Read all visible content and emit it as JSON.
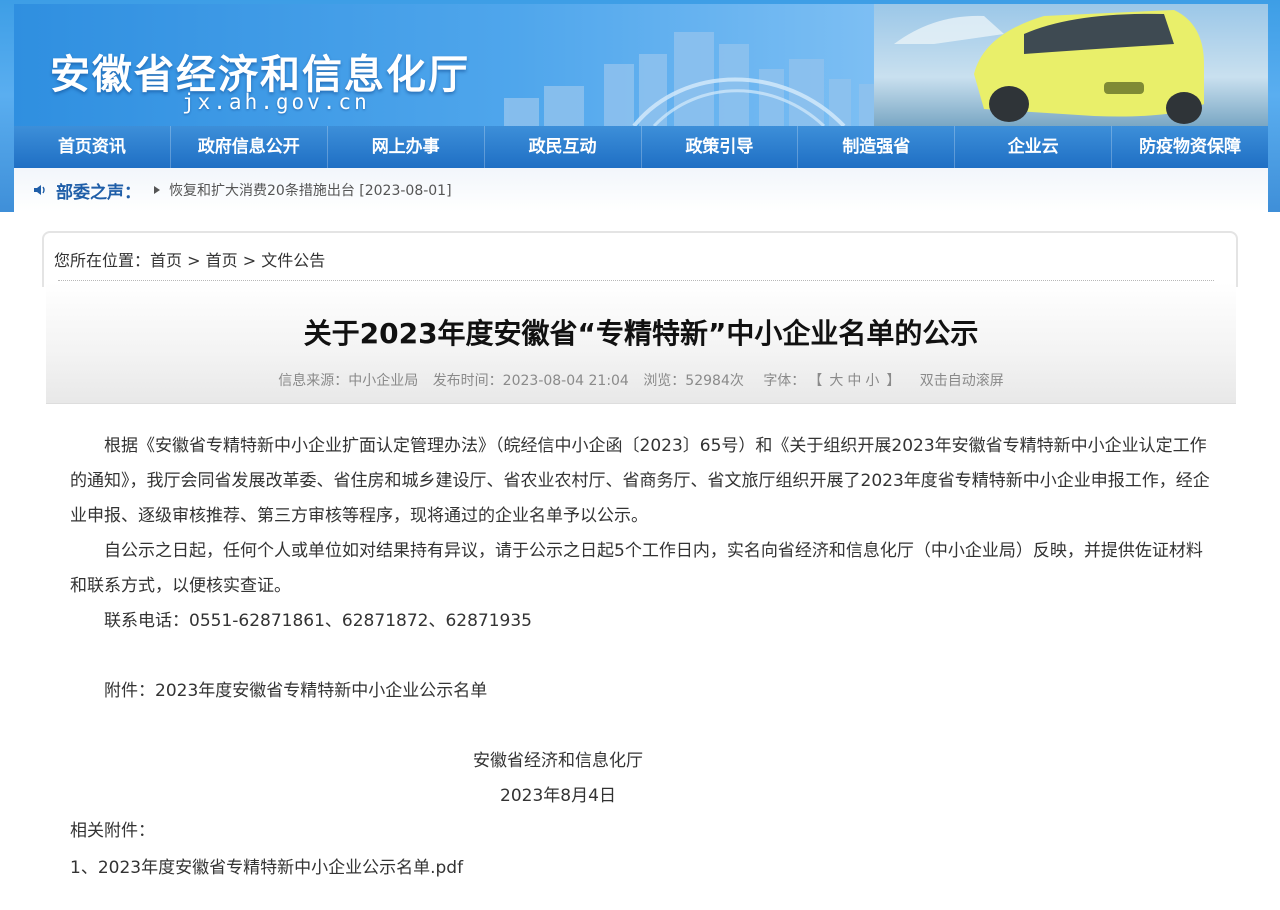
{
  "header": {
    "title": "安徽省经济和信息化厅",
    "domain": "jx.ah.gov.cn"
  },
  "nav": {
    "items": [
      "首页资讯",
      "政府信息公开",
      "网上办事",
      "政民互动",
      "政策引导",
      "制造强省",
      "企业云",
      "防疫物资保障"
    ]
  },
  "notice": {
    "title": "部委之声：",
    "text": "恢复和扩大消费20条措施出台 [2023-08-01]"
  },
  "breadcrumb": {
    "prefix": "您所在位置：",
    "items": [
      "首页",
      "首页",
      "文件公告"
    ],
    "sep": " > "
  },
  "article": {
    "title": "关于2023年度安徽省“专精特新”中小企业名单的公示",
    "meta": {
      "source": "信息来源：中小企业局",
      "date": "发布时间：2023-08-04 21:04",
      "views": "浏览：52984次",
      "font_label": "字体：",
      "font_open": "【",
      "font_large": "大",
      "font_medium": "中",
      "font_small": "小",
      "font_close": "】",
      "autoscroll": "双击自动滚屏"
    },
    "p1": "根据《安徽省专精特新中小企业扩面认定管理办法》（皖经信中小企函〔2023〕65号）和《关于组织开展2023年安徽省专精特新中小企业认定工作的通知》，我厅会同省发展改革委、省住房和城乡建设厅、省农业农村厅、省商务厅、省文旅厅组织开展了2023年度省专精特新中小企业申报工作，经企业申报、逐级审核推荐、第三方审核等程序，现将通过的企业名单予以公示。",
    "p2": "自公示之日起，任何个人或单位如对结果持有异议，请于公示之日起5个工作日内，实名向省经济和信息化厅（中小企业局）反映，并提供佐证材料和联系方式，以便核实查证。",
    "p3": "联系电话：0551-62871861、62871872、62871935",
    "p4": "附件：2023年度安徽省专精特新中小企业公示名单",
    "sig_org": "安徽省经济和信息化厅",
    "sig_date": "2023年8月4日",
    "attach_head": "相关附件：",
    "attach_link": "1、2023年度安徽省专精特新中小企业公示名单.pdf"
  },
  "colors": {
    "nav": "#1f6fc4",
    "notice_title": "#1f5ea8",
    "banner": "#4fa6ec"
  }
}
